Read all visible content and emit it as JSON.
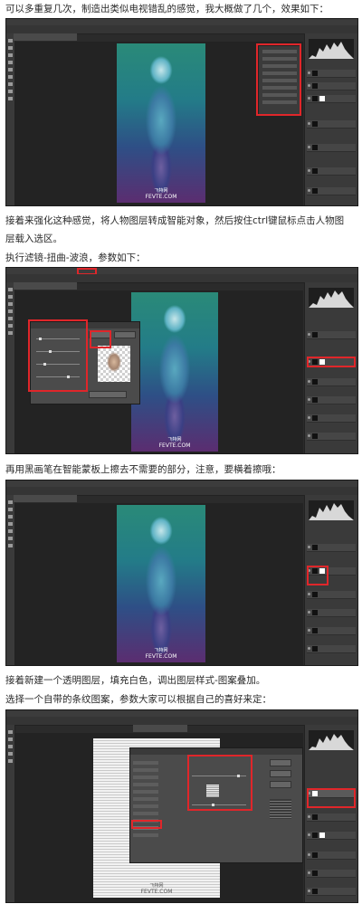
{
  "paragraphs": {
    "p1": "可以多重复几次，制造出类似电视错乱的感觉，我大概做了几个，效果如下：",
    "p2a": "接着来强化这种感觉，将人物图层转成智能对象，然后按住ctrl键鼠标点击人物图",
    "p2b": "层载入选区。",
    "p3": "执行滤镜-扭曲-波浪，参数如下：",
    "p4": "再用黑画笔在智能蒙板上擦去不需要的部分，注意，要横着擦哦：",
    "p5": "接着新建一个透明图层，填充白色，调出图层样式-图案叠加。",
    "p6": "选择一个自带的条纹图案，参数大家可以根据自己的喜好来定："
  },
  "watermark": {
    "site": "FEVTE.COM",
    "name": "飞特网"
  },
  "colors": {
    "highlight": "#e0262a",
    "ui_dark": "#2b2b2b",
    "ui_panel": "#3a3a3a"
  },
  "icons": [
    "eye-icon",
    "layer-thumbnail",
    "tool-icon"
  ]
}
